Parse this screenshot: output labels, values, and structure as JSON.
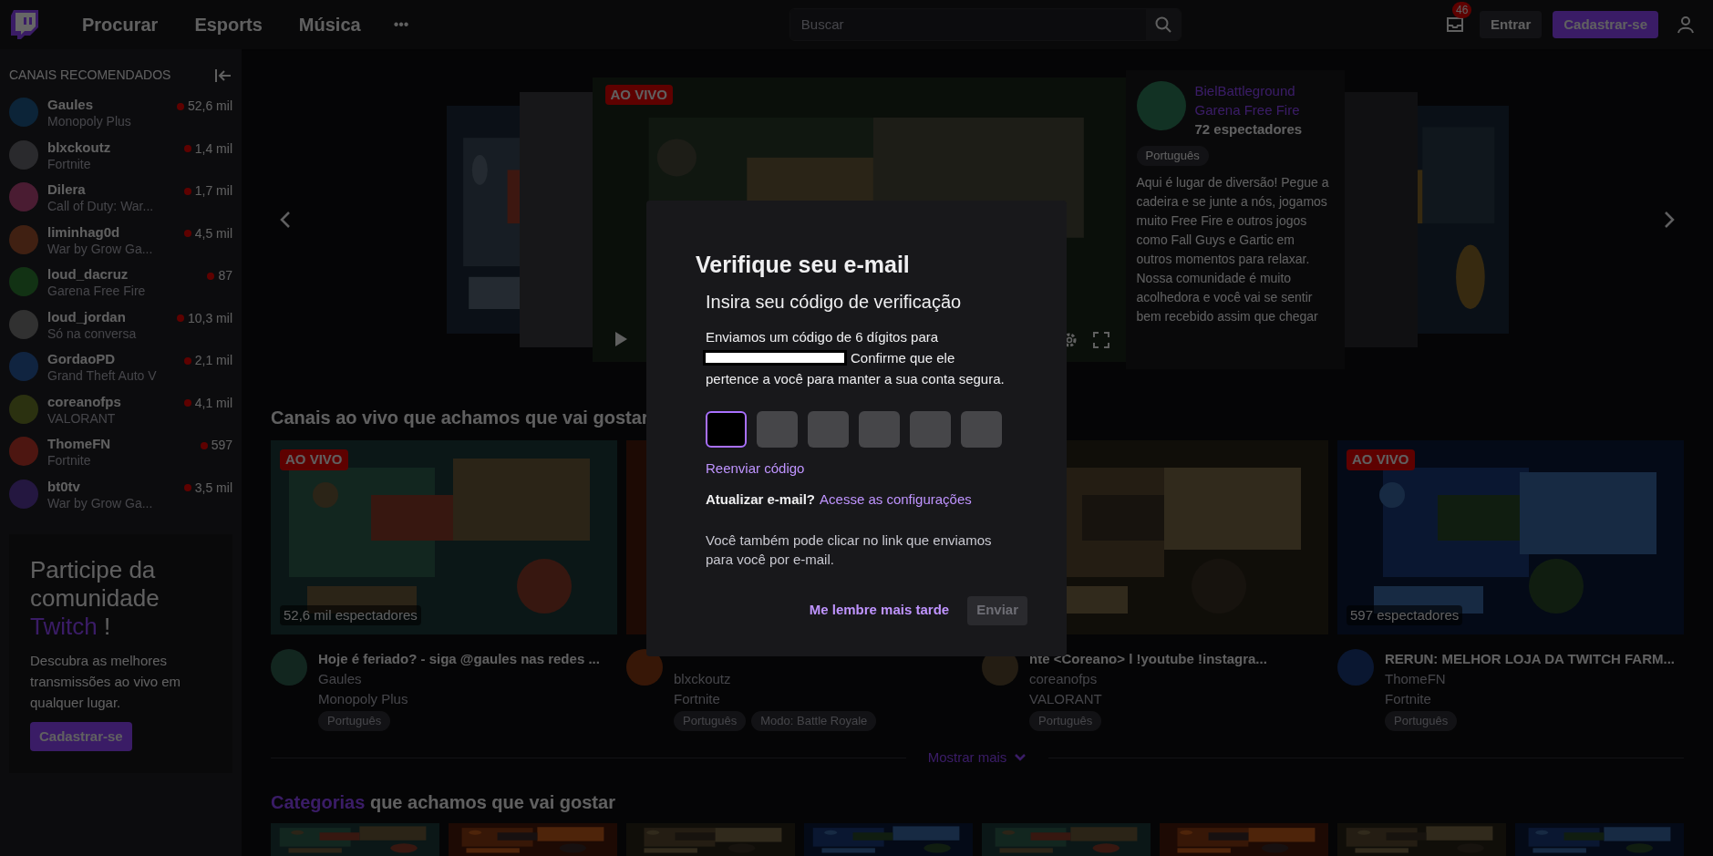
{
  "nav": {
    "links": [
      "Procurar",
      "Esports",
      "Música"
    ],
    "more": "•••",
    "search": {
      "placeholder": "Buscar"
    },
    "notifications": "46",
    "login": "Entrar",
    "signup": "Cadastrar-se"
  },
  "sidebar": {
    "title": "CANAIS RECOMENDADOS",
    "channels": [
      {
        "name": "Gaules",
        "game": "Monopoly Plus",
        "viewers": "52,6 mil"
      },
      {
        "name": "blxckoutz",
        "game": "Fortnite",
        "viewers": "1,4 mil"
      },
      {
        "name": "Dilera",
        "game": "Call of Duty: War...",
        "viewers": "1,7 mil"
      },
      {
        "name": "liminhag0d",
        "game": "War by Grow Ga...",
        "viewers": "4,5 mil"
      },
      {
        "name": "loud_dacruz",
        "game": "Garena Free Fire",
        "viewers": "87"
      },
      {
        "name": "loud_jordan",
        "game": "Só na conversa",
        "viewers": "10,3 mil"
      },
      {
        "name": "GordaoPD",
        "game": "Grand Theft Auto V",
        "viewers": "2,1 mil"
      },
      {
        "name": "coreanofps",
        "game": "VALORANT",
        "viewers": "4,1 mil"
      },
      {
        "name": "ThomeFN",
        "game": "Fortnite",
        "viewers": "597"
      },
      {
        "name": "bt0tv",
        "game": "War by Grow Ga...",
        "viewers": "3,5 mil"
      }
    ],
    "promo": {
      "heading": "Participe da comunidade",
      "brand": "Twitch",
      "suffix": "!",
      "text": "Descubra as melhores transmissões ao vivo em qualquer lugar.",
      "button": "Cadastrar-se"
    }
  },
  "featured": {
    "live_badge": "AO VIVO",
    "channel": "BielBattleground",
    "game": "Garena Free Fire",
    "viewers": "72 espectadores",
    "tag": "Português",
    "description": "Aqui é lugar de diversão! Pegue a cadeira e se junte a nós, jogamos muito Free Fire e outros jogos como Fall Guys e Gartic em outros momentos para relaxar. Nossa comunidade é muito acolhedora e você vai se sentir bem recebido assim que chegar"
  },
  "live_section": {
    "title": "Canais ao vivo que achamos que vai gostar",
    "cards": [
      {
        "badge": "AO VIVO",
        "viewers": "52,6 mil espectadores",
        "title": "Hoje é feriado? - siga @gaules nas redes ...",
        "channel": "Gaules",
        "game": "Monopoly Plus",
        "tags": [
          "Português"
        ]
      },
      {
        "channel": "blxckoutz",
        "game": "Fortnite",
        "tags": [
          "Português",
          "Modo: Battle Royale"
        ]
      },
      {
        "title": "nte <Coreano> l !youtube !instagra...",
        "channel": "coreanofps",
        "game": "VALORANT",
        "tags": [
          "Português"
        ]
      },
      {
        "badge": "AO VIVO",
        "viewers": "597 espectadores",
        "title": "RERUN: MELHOR LOJA DA TWITCH FARM...",
        "channel": "ThomeFN",
        "game": "Fortnite",
        "tags": [
          "Português"
        ]
      }
    ],
    "show_more": "Mostrar mais"
  },
  "categories_section": {
    "link": "Categorias",
    "title": "que achamos que vai gostar"
  },
  "modal": {
    "title": "Verifique seu e-mail",
    "subtitle": "Insira seu código de verificação",
    "text_before": "Enviamos um código de 6 dígitos para",
    "text_middle": "Confirme que ele",
    "text_after": "pertence a você para manter a sua conta segura.",
    "code_boxes": [
      {
        "selected": true
      },
      {
        "selected": false
      },
      {
        "selected": false
      },
      {
        "selected": false
      },
      {
        "selected": false
      },
      {
        "selected": false
      }
    ],
    "resend": "Reenviar código",
    "update_label": "Atualizar e-mail?",
    "update_link": "Acesse as configurações",
    "hint": "Você também pode clicar no link que enviamos para você por e-mail.",
    "later": "Me lembre mais tarde",
    "submit": {
      "label": "Enviar",
      "disabled": true
    }
  }
}
